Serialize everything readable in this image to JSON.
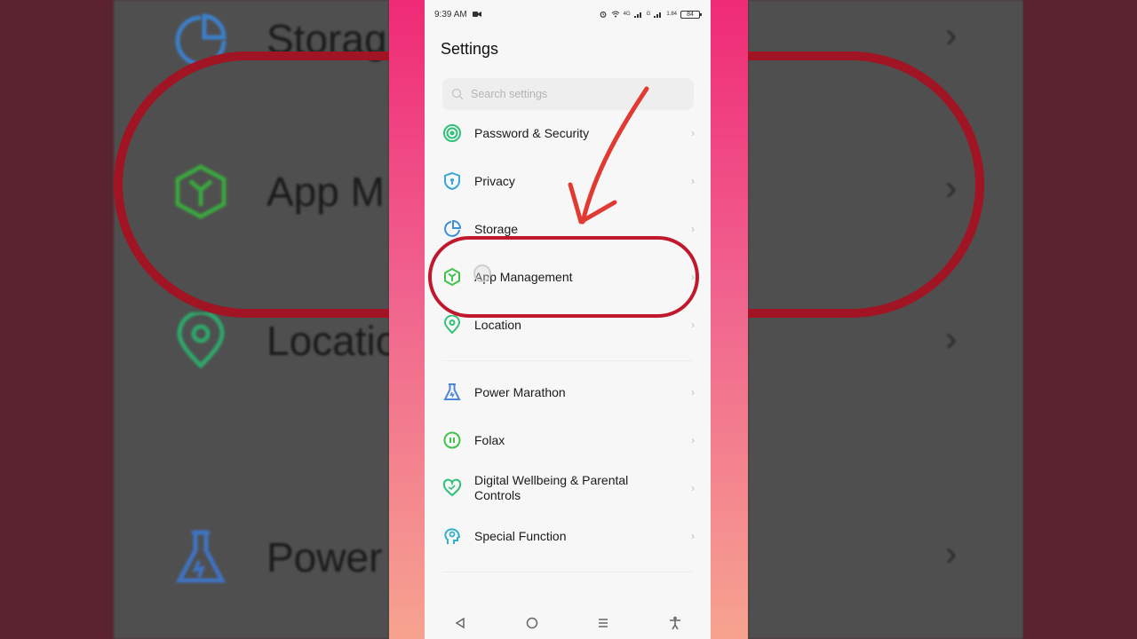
{
  "status_bar": {
    "time": "9:39 AM",
    "net_4g": "4G",
    "net_g": "G",
    "speed": "1.84",
    "battery": "84"
  },
  "page_title": "Settings",
  "search": {
    "placeholder": "Search settings"
  },
  "items": [
    {
      "label": "Password & Security",
      "icon": "password-icon",
      "color": "#2fc07a"
    },
    {
      "label": "Privacy",
      "icon": "shield-icon",
      "color": "#3aa7d6"
    },
    {
      "label": "Storage",
      "icon": "pie-chart-icon",
      "color": "#3c8fd9"
    },
    {
      "label": "App Management",
      "icon": "cube-icon",
      "color": "#3fc34a"
    },
    {
      "label": "Location",
      "icon": "location-pin-icon",
      "color": "#32c17a"
    },
    {
      "label": "Power Marathon",
      "icon": "flask-icon",
      "color": "#4c86d6"
    },
    {
      "label": "Folax",
      "icon": "folax-icon",
      "color": "#3fc34a"
    },
    {
      "label": "Digital Wellbeing & Parental Controls",
      "icon": "heart-icon",
      "color": "#2fc07a"
    },
    {
      "label": "Special Function",
      "icon": "head-icon",
      "color": "#2fb0c7"
    }
  ],
  "background_zoom": {
    "storage": "Storag",
    "app_management": "App M",
    "location": "Locatio",
    "power": "Power"
  },
  "colors": {
    "accent_red": "#c0182c",
    "gradient_top": "#ef2a76",
    "gradient_bottom": "#f6a38f"
  }
}
